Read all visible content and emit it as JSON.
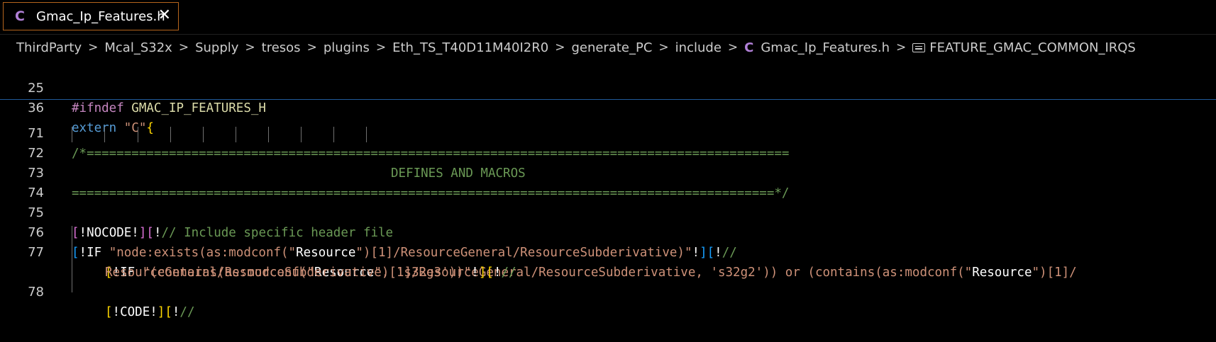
{
  "tab": {
    "icon": "C",
    "label": "Gmac_Ip_Features.h",
    "close": "✕"
  },
  "breadcrumb": [
    "ThirdParty",
    "Mcal_S32x",
    "Supply",
    "tresos",
    "plugins",
    "Eth_TS_T40D11M40I2R0",
    "generate_PC",
    "include"
  ],
  "breadcrumb_file": {
    "icon": "C",
    "label": "Gmac_Ip_Features.h"
  },
  "breadcrumb_symbol": "FEATURE_GMAC_COMMON_IRQS",
  "sticky": [
    {
      "num": "25",
      "a": "#ifndef",
      "b": " GMAC_IP_FEATURES_H"
    },
    {
      "num": "36",
      "a": "extern",
      "b": " \"C\"",
      "c": "{"
    }
  ],
  "lines": {
    "l71": {
      "num": "71",
      "text": "/*=============================================================================================="
    },
    "l72": {
      "num": "72",
      "text": "DEFINES AND MACROS"
    },
    "l73": {
      "num": "73",
      "text": "==============================================================================================*/"
    },
    "l74": {
      "num": "74"
    },
    "l75": {
      "num": "75",
      "p1": "[",
      "p2": "!NOCODE!",
      "p3": "]",
      "p4": "[",
      "p5": "!",
      "p6": "// Include specific header file"
    },
    "l76": {
      "num": "76",
      "p1": "[",
      "p2": "!IF",
      "p3": " \"node:exists(as:modconf(\"",
      "p4": "Resource",
      "p5": "\")[1]/ResourceGeneral/ResourceSubderivative)\"",
      "p6": "!",
      "p7": "]",
      "p8": "[",
      "p9": "!",
      "p10": "//"
    },
    "l77": {
      "num": "77",
      "p1": "[",
      "p2": "!IF",
      "p3": " \"(contains(as:modconf(\"",
      "p4": "Resource",
      "p5": "\")[1]/ResourceGeneral/ResourceSubderivative, 's32g2')) or (contains(as:modconf(\"",
      "p6": "Resource",
      "p7": "\")[1]/",
      "cont": "ResourceGeneral/ResourceSubderivative, 's32g3'))\"",
      "p8": "!",
      "p9": "]",
      "p10": "[",
      "p11": "!",
      "p12": "//"
    },
    "l78": {
      "num": "78",
      "p1": "[",
      "p2": "!CODE!",
      "p3": "]",
      "p4": "[",
      "p5": "!",
      "p6": "//"
    }
  },
  "colors": {
    "comment": "#6a9955",
    "keyword": "#c586c0",
    "string": "#ce9178",
    "macro": "#dcdcaa"
  }
}
